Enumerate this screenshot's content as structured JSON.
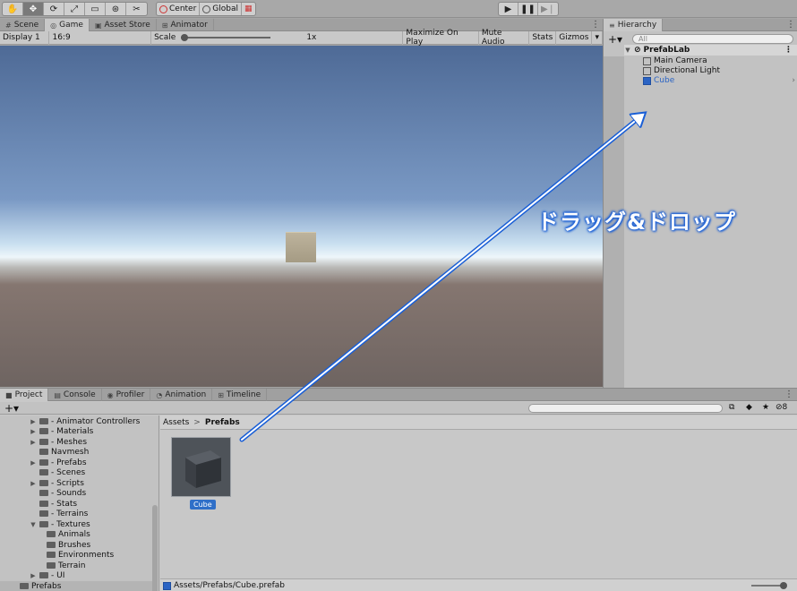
{
  "toolbar": {
    "tools": [
      "hand-tool",
      "move-tool",
      "rotate-tool",
      "scale-tool",
      "rect-tool",
      "transform-tool",
      "custom-tool"
    ],
    "pivot_label": "Center",
    "space_label": "Global",
    "play_controls": [
      "play",
      "pause",
      "step"
    ]
  },
  "scene_tabs": [
    {
      "label": "Scene",
      "icon": "grid-icon"
    },
    {
      "label": "Game",
      "icon": "gamepad-icon",
      "active": true
    },
    {
      "label": "Asset Store",
      "icon": "store-icon"
    },
    {
      "label": "Animator",
      "icon": "animator-icon"
    }
  ],
  "game_options": {
    "display": "Display 1",
    "aspect": "16:9",
    "scale_label": "Scale",
    "scale_value": "1x",
    "maximize": "Maximize On Play",
    "mute": "Mute Audio",
    "stats": "Stats",
    "gizmos": "Gizmos"
  },
  "hierarchy": {
    "title": "Hierarchy",
    "search_placeholder": "All",
    "scene_name": "PrefabLab",
    "items": [
      "Main Camera",
      "Directional Light",
      "Cube"
    ]
  },
  "bottom_tabs": [
    {
      "label": "Project",
      "icon": "folder-icon",
      "active": true
    },
    {
      "label": "Console",
      "icon": "console-icon"
    },
    {
      "label": "Profiler",
      "icon": "profiler-icon"
    },
    {
      "label": "Animation",
      "icon": "animation-icon"
    },
    {
      "label": "Timeline",
      "icon": "timeline-icon"
    }
  ],
  "project": {
    "tree": [
      {
        "label": "- Animator Controllers"
      },
      {
        "label": "- Materials"
      },
      {
        "label": "- Meshes"
      },
      {
        "label": "Navmesh"
      },
      {
        "label": "- Prefabs"
      },
      {
        "label": "- Scenes"
      },
      {
        "label": "- Scripts"
      },
      {
        "label": "- Sounds"
      },
      {
        "label": "- Stats"
      },
      {
        "label": "- Terrains"
      },
      {
        "label": "- Textures"
      },
      {
        "label": "Animals"
      },
      {
        "label": "Brushes"
      },
      {
        "label": "Environments"
      },
      {
        "label": "Terrain"
      },
      {
        "label": "- UI"
      },
      {
        "label": "Prefabs"
      }
    ],
    "breadcrumb_root": "Assets",
    "breadcrumb_current": "Prefabs",
    "asset_name": "Cube",
    "status_path": "Assets/Prefabs/Cube.prefab",
    "hidden_count": "8"
  },
  "annotation": {
    "text": "ドラッグ&ドロップ",
    "color": "#1a5fd6"
  }
}
